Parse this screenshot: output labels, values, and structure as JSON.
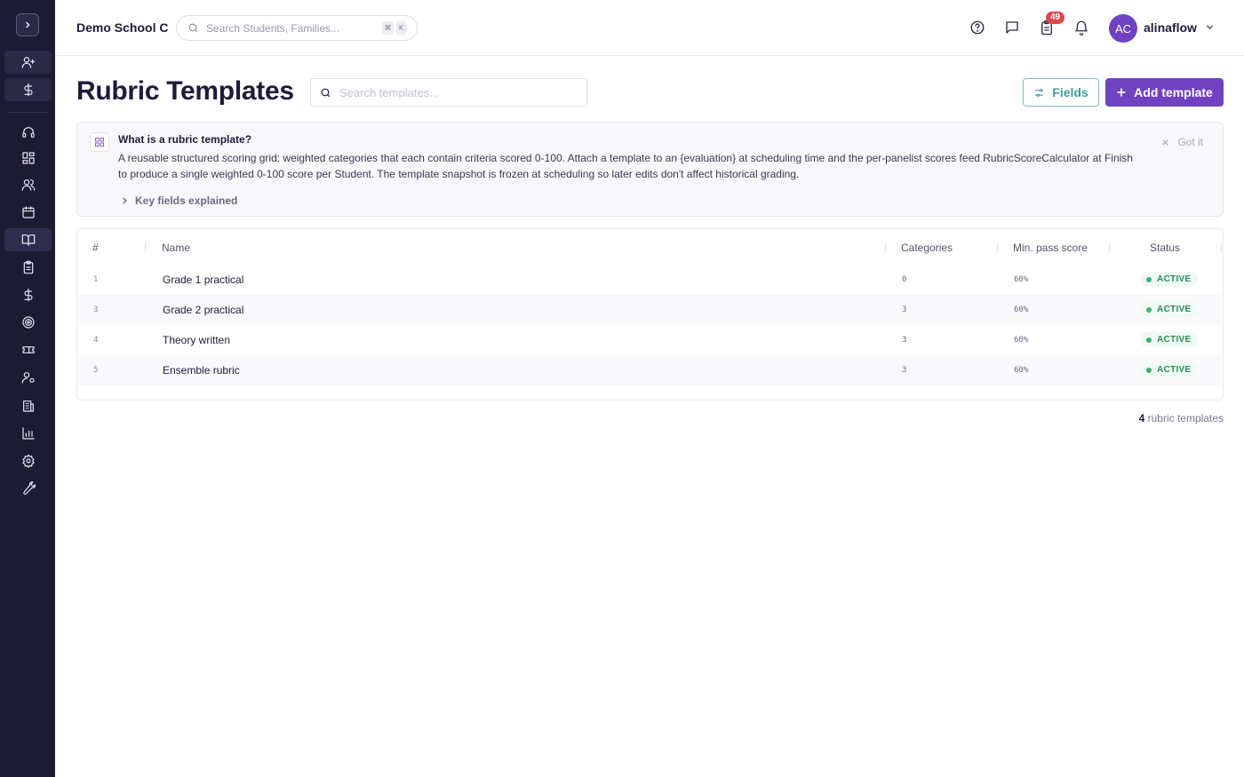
{
  "app": {
    "school_name": "Demo School C"
  },
  "search": {
    "placeholder": "Search Students, Families...",
    "kbd_1": "⌘",
    "kbd_2": "K"
  },
  "header": {
    "badge_count": "49",
    "avatar_initials": "AC",
    "username": "alinaflow"
  },
  "sidebar": {
    "items": [
      "add-user",
      "billing",
      "support",
      "dashboard",
      "people",
      "calendar",
      "curriculum",
      "assignments",
      "finance",
      "goals",
      "tickets",
      "staff",
      "buildings",
      "reports",
      "settings",
      "tools"
    ],
    "active": "curriculum"
  },
  "page": {
    "title": "Rubric Templates",
    "search_placeholder": "Search templates...",
    "fields_button": "Fields",
    "add_button": "Add template"
  },
  "callout": {
    "title": "What is a rubric template?",
    "body": "A reusable structured scoring grid: weighted categories that each contain criteria scored 0-100. Attach a template to an {evaluation} at scheduling time and the per-panelist scores feed RubricScoreCalculator at Finish to produce a single weighted 0-100 score per Student. The template snapshot is frozen at scheduling so later edits don't affect historical grading.",
    "more": "Key fields explained",
    "dismiss": "Got it"
  },
  "table": {
    "headers": {
      "num": "#",
      "name": "Name",
      "categories": "Categories",
      "min_pass": "Min. pass score",
      "status": "Status"
    },
    "rows": [
      {
        "num": "1",
        "name": "Grade 1 practical",
        "categories": "0",
        "min_pass": "60%",
        "status": "ACTIVE"
      },
      {
        "num": "3",
        "name": "Grade 2 practical",
        "categories": "3",
        "min_pass": "60%",
        "status": "ACTIVE"
      },
      {
        "num": "4",
        "name": "Theory written",
        "categories": "3",
        "min_pass": "60%",
        "status": "ACTIVE"
      },
      {
        "num": "5",
        "name": "Ensemble rubric",
        "categories": "3",
        "min_pass": "60%",
        "status": "ACTIVE"
      }
    ]
  },
  "footer": {
    "count": "4",
    "count_label": "rubric templates"
  },
  "colors": {
    "accent": "#6f42c1",
    "sidebar_bg": "#1c1b33",
    "teal": "#3f9e9e",
    "active_green": "#2a8a57",
    "badge_red": "#e0464a"
  }
}
